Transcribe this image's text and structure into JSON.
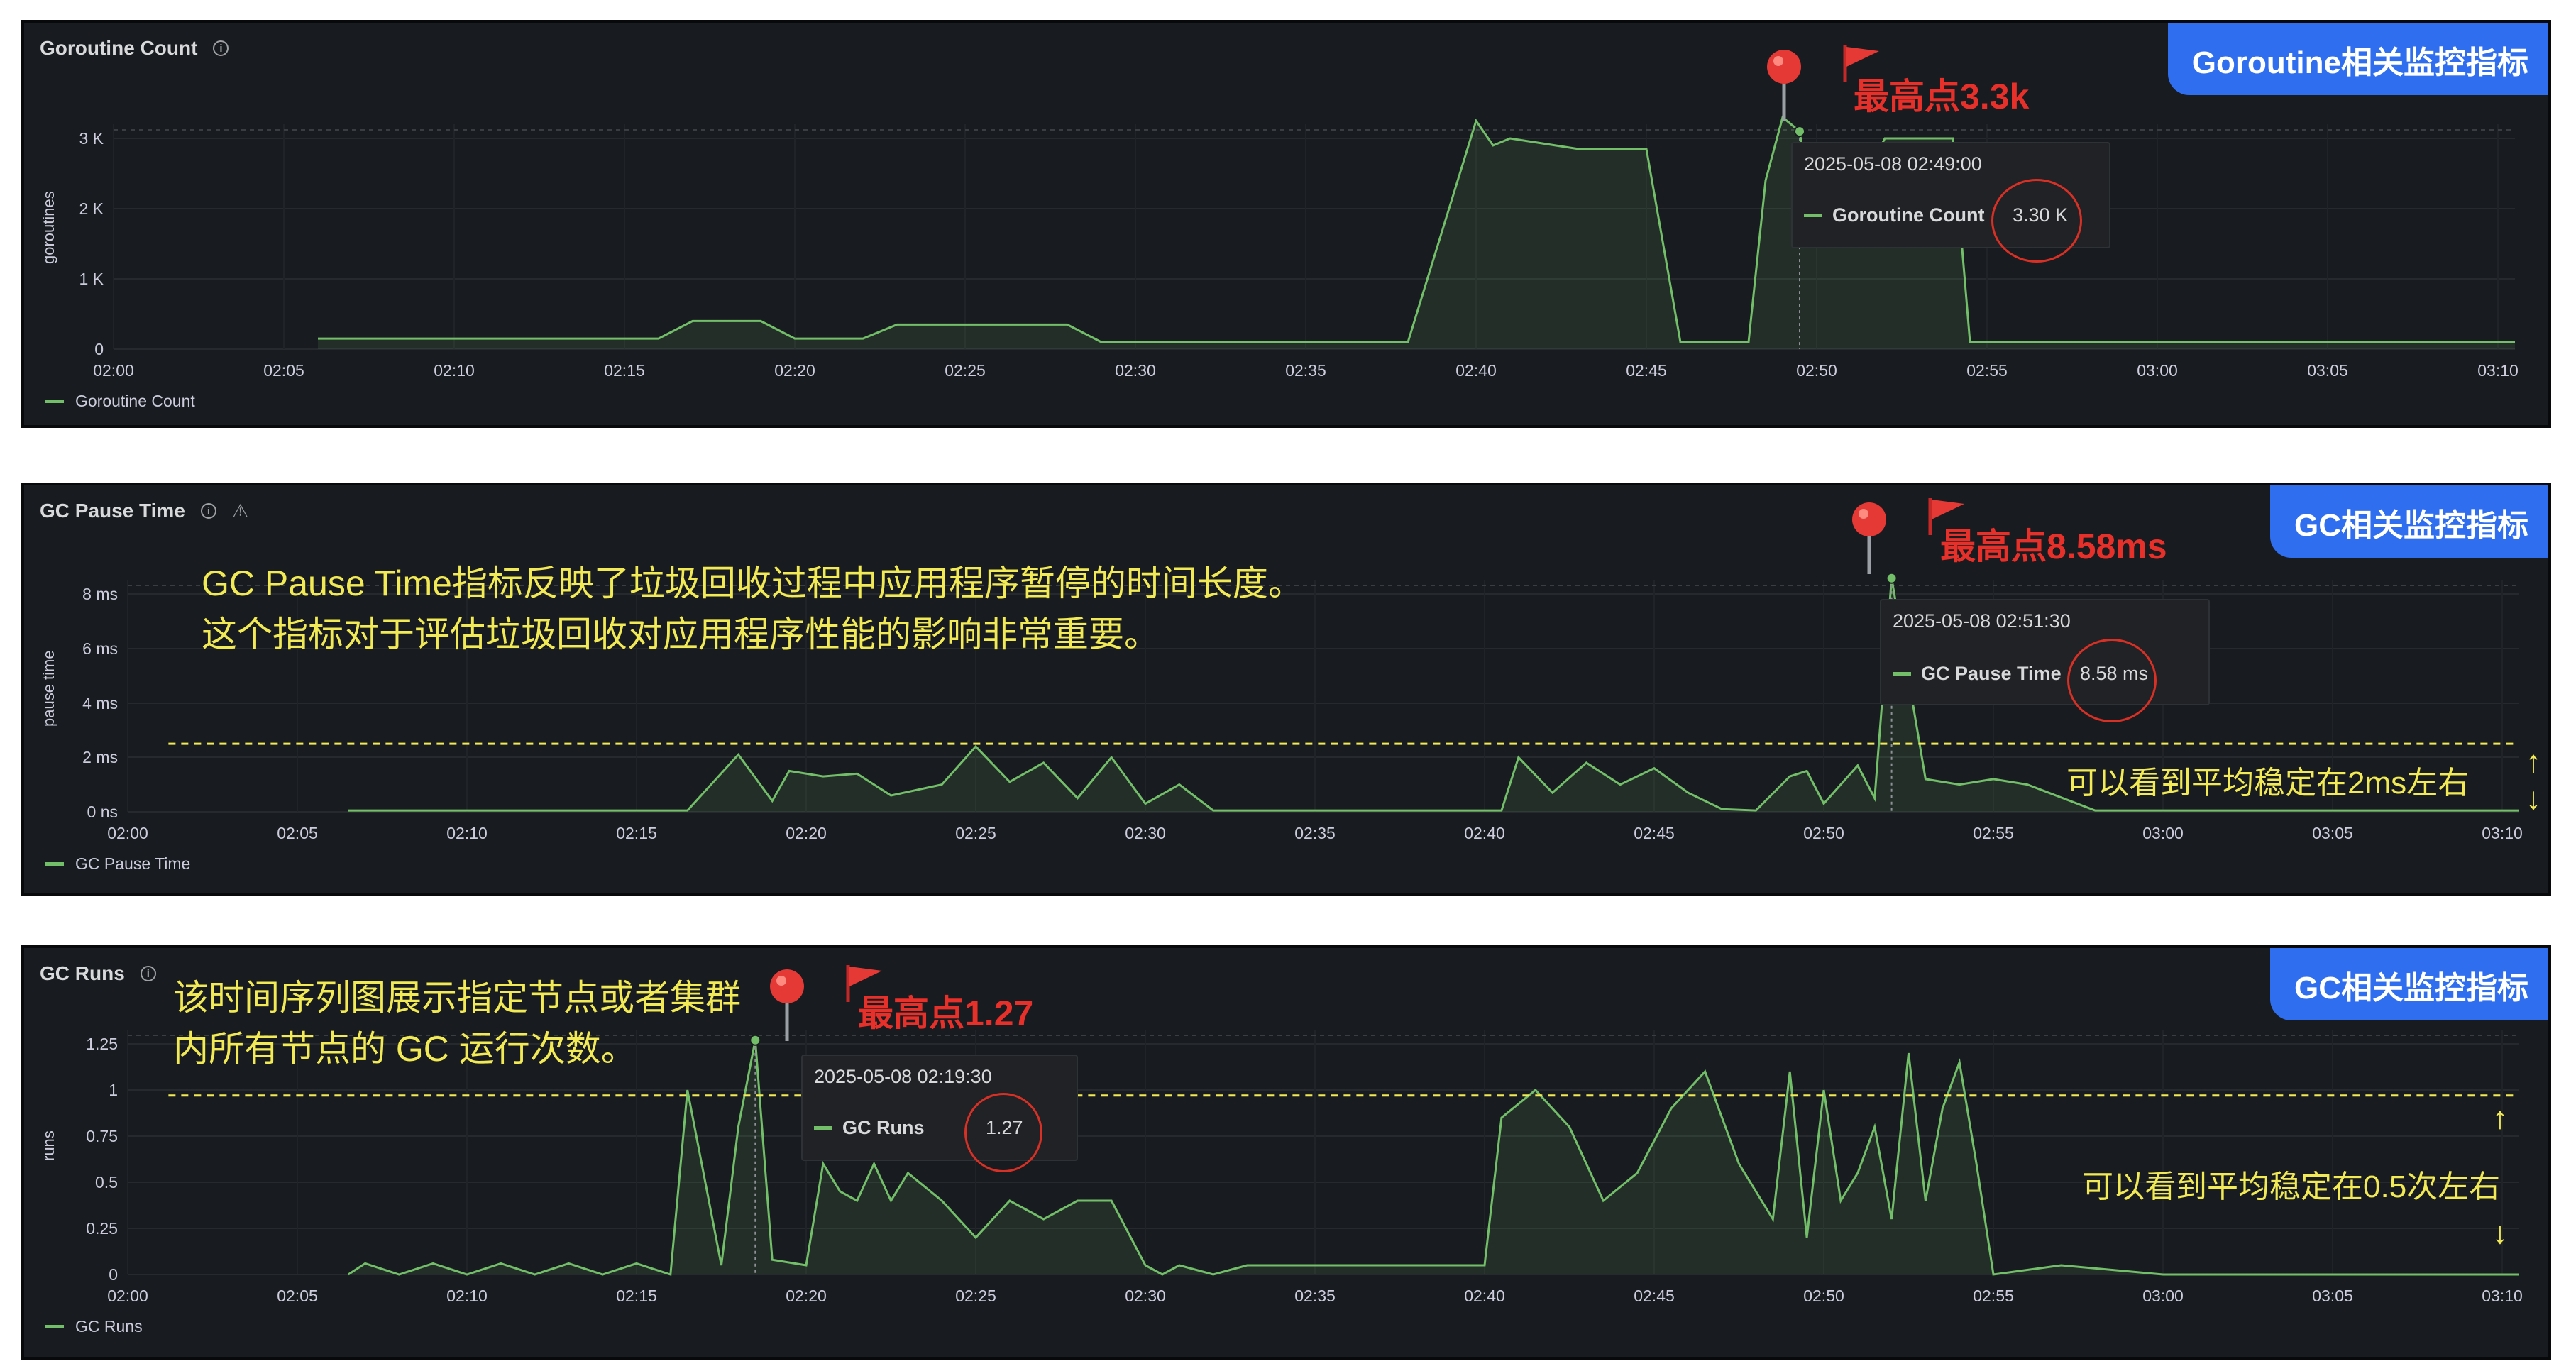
{
  "panels": [
    {
      "title": "Goroutine Count",
      "banner": "Goroutine相关监控指标",
      "ylabel": "goroutines",
      "legend": "Goroutine Count",
      "peak_label": "最高点3.3k",
      "tooltip": {
        "time": "2025-05-08 02:49:00",
        "series": "Goroutine Count",
        "value": "3.30 K"
      },
      "yticks": [
        "3 K",
        "2 K",
        "1 K",
        "0"
      ]
    },
    {
      "title": "GC Pause Time",
      "banner": "GC相关监控指标",
      "ylabel": "pause time",
      "legend": "GC Pause Time",
      "peak_label": "最高点8.58ms",
      "tooltip": {
        "time": "2025-05-08 02:51:30",
        "series": "GC Pause Time",
        "value": "8.58 ms"
      },
      "yticks": [
        "8 ms",
        "6 ms",
        "4 ms",
        "2 ms",
        "0 ns"
      ],
      "note_lines": [
        "GC Pause Time指标反映了垃圾回收过程中应用程序暂停的时间长度。",
        "这个指标对于评估垃圾回收对应用程序性能的影响非常重要。"
      ],
      "avg_note": "可以看到平均稳定在2ms左右"
    },
    {
      "title": "GC Runs",
      "banner": "GC相关监控指标",
      "ylabel": "runs",
      "legend": "GC Runs",
      "peak_label": "最高点1.27",
      "tooltip": {
        "time": "2025-05-08 02:19:30",
        "series": "GC Runs",
        "value": "1.27"
      },
      "yticks": [
        "1.25",
        "1",
        "0.75",
        "0.5",
        "0.25",
        "0"
      ],
      "note_lines": [
        "该时间序列图展示指定节点或者集群",
        "内所有节点的 GC 运行次数。"
      ],
      "avg_note": "可以看到平均稳定在0.5次左右"
    }
  ],
  "colors": {
    "series": "#73bf69",
    "annotation": "#e8302a",
    "banner": "#2f6fef",
    "note": "#f2ea55"
  },
  "chart_data": [
    {
      "type": "area",
      "title": "Goroutine Count",
      "ylabel": "goroutines",
      "xticks": [
        "02:00",
        "02:05",
        "02:10",
        "02:15",
        "02:20",
        "02:25",
        "02:30",
        "02:35",
        "02:40",
        "02:45",
        "02:50",
        "02:55",
        "03:00",
        "03:05",
        "03:10"
      ],
      "ylim": [
        0,
        3300
      ],
      "series": [
        {
          "name": "Goroutine Count",
          "x": [
            6,
            16,
            17,
            19,
            20,
            22,
            23,
            28,
            29,
            38,
            40,
            40.5,
            41,
            43,
            45,
            46,
            48,
            48.5,
            49,
            49.5,
            50,
            51,
            52,
            54,
            54.5,
            55,
            60,
            66,
            70.5
          ],
          "y": [
            150,
            150,
            400,
            400,
            150,
            150,
            350,
            350,
            100,
            100,
            3250,
            2900,
            3000,
            2850,
            2850,
            100,
            100,
            2400,
            3300,
            3100,
            1500,
            2000,
            3000,
            3000,
            100,
            100,
            100,
            100,
            100
          ]
        }
      ]
    },
    {
      "type": "area",
      "title": "GC Pause Time",
      "ylabel": "pause time",
      "xticks": [
        "02:00",
        "02:05",
        "02:10",
        "02:15",
        "02:20",
        "02:25",
        "02:30",
        "02:35",
        "02:40",
        "02:45",
        "02:50",
        "02:55",
        "03:00",
        "03:05",
        "03:10"
      ],
      "ylim": [
        0,
        8.58
      ],
      "reference_line": 2.5,
      "series": [
        {
          "name": "GC Pause Time",
          "x": [
            6.5,
            16.5,
            18,
            19,
            19.5,
            20.5,
            21.5,
            22.5,
            24,
            25,
            26,
            27,
            28,
            29,
            30,
            31,
            32,
            35,
            40.5,
            41,
            42,
            43,
            44,
            45,
            46,
            47,
            48,
            49,
            49.5,
            50,
            51,
            51.5,
            52,
            53,
            54,
            55,
            56,
            58,
            60,
            65,
            70.5
          ],
          "y": [
            0.05,
            0.05,
            2.1,
            0.4,
            1.5,
            1.3,
            1.4,
            0.6,
            1.0,
            2.4,
            1.1,
            1.8,
            0.5,
            2.0,
            0.3,
            1.0,
            0.05,
            0.05,
            0.05,
            2.0,
            0.7,
            1.8,
            1.0,
            1.6,
            0.7,
            0.1,
            0.05,
            1.3,
            1.5,
            0.3,
            1.7,
            0.5,
            8.58,
            1.2,
            1.0,
            1.2,
            1.0,
            0.05,
            0.05,
            0.05,
            0.05
          ]
        }
      ]
    },
    {
      "type": "area",
      "title": "GC Runs",
      "ylabel": "runs",
      "xticks": [
        "02:00",
        "02:05",
        "02:10",
        "02:15",
        "02:20",
        "02:25",
        "02:30",
        "02:35",
        "02:40",
        "02:45",
        "02:50",
        "02:55",
        "03:00",
        "03:05",
        "03:10"
      ],
      "ylim": [
        0,
        1.27
      ],
      "reference_line": 0.97,
      "series": [
        {
          "name": "GC Runs",
          "x": [
            6.5,
            7,
            8,
            9,
            10,
            11,
            12,
            13,
            14,
            15,
            16,
            16.5,
            17.5,
            18,
            18.5,
            19,
            20,
            20.5,
            21,
            21.5,
            22,
            22.5,
            23,
            24,
            25,
            26,
            27,
            28,
            29,
            30,
            30.5,
            31,
            32,
            33,
            40,
            40.5,
            41.5,
            42.5,
            43.5,
            44.5,
            45.5,
            46.5,
            47.5,
            48.5,
            49,
            49.5,
            50,
            50.5,
            51,
            51.5,
            52,
            52.5,
            53,
            53.5,
            54,
            54.5,
            55,
            57,
            60,
            70.5
          ],
          "y": [
            0,
            0.06,
            0,
            0.06,
            0,
            0.06,
            0,
            0.06,
            0,
            0.06,
            0,
            1.0,
            0.05,
            0.8,
            1.27,
            0.08,
            0.05,
            0.6,
            0.45,
            0.4,
            0.6,
            0.4,
            0.55,
            0.4,
            0.2,
            0.4,
            0.3,
            0.4,
            0.4,
            0.05,
            0,
            0.05,
            0,
            0.05,
            0.05,
            0.85,
            1.0,
            0.8,
            0.4,
            0.55,
            0.9,
            1.1,
            0.6,
            0.3,
            1.1,
            0.2,
            1.0,
            0.4,
            0.55,
            0.8,
            0.3,
            1.2,
            0.4,
            0.9,
            1.15,
            0.6,
            0,
            0.05,
            0,
            0
          ]
        }
      ]
    }
  ]
}
